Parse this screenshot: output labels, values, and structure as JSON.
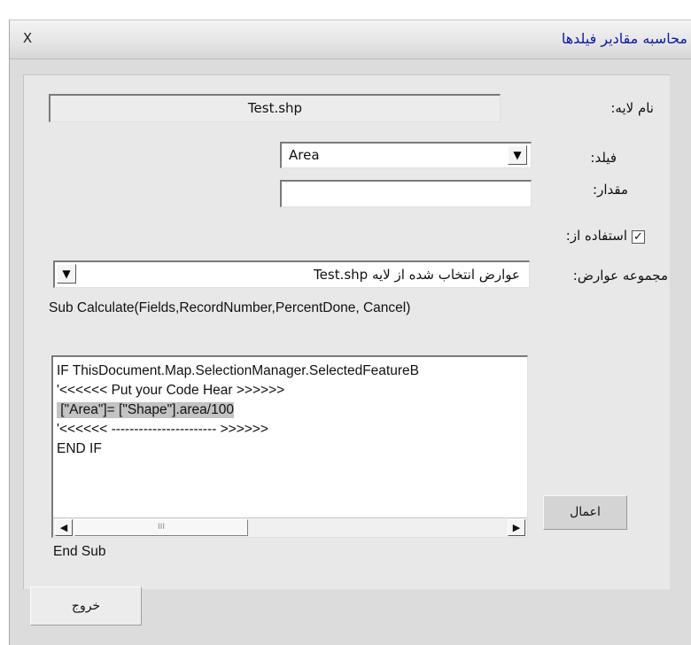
{
  "window": {
    "title": "محاسبه مقادیر فیلدها",
    "close_label": "X"
  },
  "form": {
    "layer_label": "نام لایه:",
    "layer_value": "Test.shp",
    "field_label": "فیلد:",
    "field_value": "Area",
    "value_label": "مقدار:",
    "value_input": "",
    "use_label": "استفاده از:",
    "use_checked": true,
    "features_label": "مجموعه عوارض:",
    "features_value": "عوارض انتخاب شده از لایه Test.shp"
  },
  "code": {
    "header": "Sub Calculate(Fields,RecordNumber,PercentDone, Cancel)",
    "lines": [
      "IF ThisDocument.Map.SelectionManager.SelectedFeatureB",
      "'<<<<<< Put your Code Hear >>>>>>",
      " [\"Area\"]= [\"Shape\"].area/100",
      "'<<<<<< ----------------------- >>>>>>",
      "END IF"
    ],
    "footer": "End Sub"
  },
  "buttons": {
    "apply": "اعمال",
    "exit": "خروج"
  },
  "icons": {
    "dropdown": "chevron-down-icon",
    "scroll_left": "arrow-left-icon",
    "scroll_right": "arrow-right-icon",
    "check": "checkmark-icon"
  }
}
